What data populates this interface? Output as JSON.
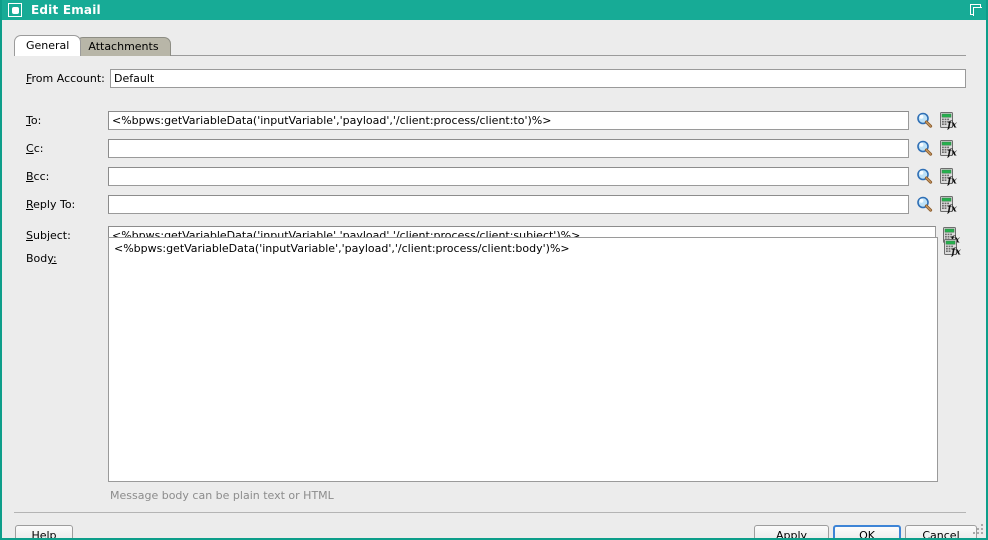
{
  "window": {
    "title": "Edit Email",
    "icon": "app-window-icon",
    "restore_button_icon": "restore-window-icon",
    "accent_color": "#17ab96"
  },
  "tabs": [
    {
      "label": "General",
      "active": true
    },
    {
      "label": "Attachments",
      "active": false
    }
  ],
  "form": {
    "from_account": {
      "label_prefix": "F",
      "label_rest": "rom Account:",
      "value": "Default",
      "placeholder": ""
    },
    "to": {
      "label_prefix": "T",
      "label_rest": "o:",
      "value": "<%bpws:getVariableData('inputVariable','payload','/client:process/client:to')%>",
      "placeholder": ""
    },
    "cc": {
      "label_prefix": "C",
      "label_rest": "c:",
      "value": "",
      "placeholder": ""
    },
    "bcc": {
      "label_prefix": "B",
      "label_rest": "cc:",
      "value": "",
      "placeholder": ""
    },
    "reply_to": {
      "label_prefix": "R",
      "label_rest": "eply To:",
      "value": "",
      "placeholder": ""
    },
    "subject": {
      "label_prefix": "S",
      "label_rest": "ubject:",
      "value": "<%bpws:getVariableData('inputVariable','payload','/client:process/client:subject')%>",
      "placeholder": ""
    },
    "body": {
      "label_prefix": "Bod",
      "label_rest": "y:",
      "value": "<%bpws:getVariableData('inputVariable','payload','/client:process/client:body')%>",
      "placeholder": "",
      "hint": "Message body can be plain text or HTML"
    }
  },
  "icons": {
    "browse": "search-magnifier-icon",
    "expression": "expression-builder-fx-icon"
  },
  "buttons": {
    "help": {
      "prefix": "H",
      "rest": "elp"
    },
    "apply": {
      "prefix": "A",
      "rest": "pply"
    },
    "ok": {
      "label": "OK",
      "focused": true
    },
    "cancel": {
      "label": "Cancel"
    }
  }
}
